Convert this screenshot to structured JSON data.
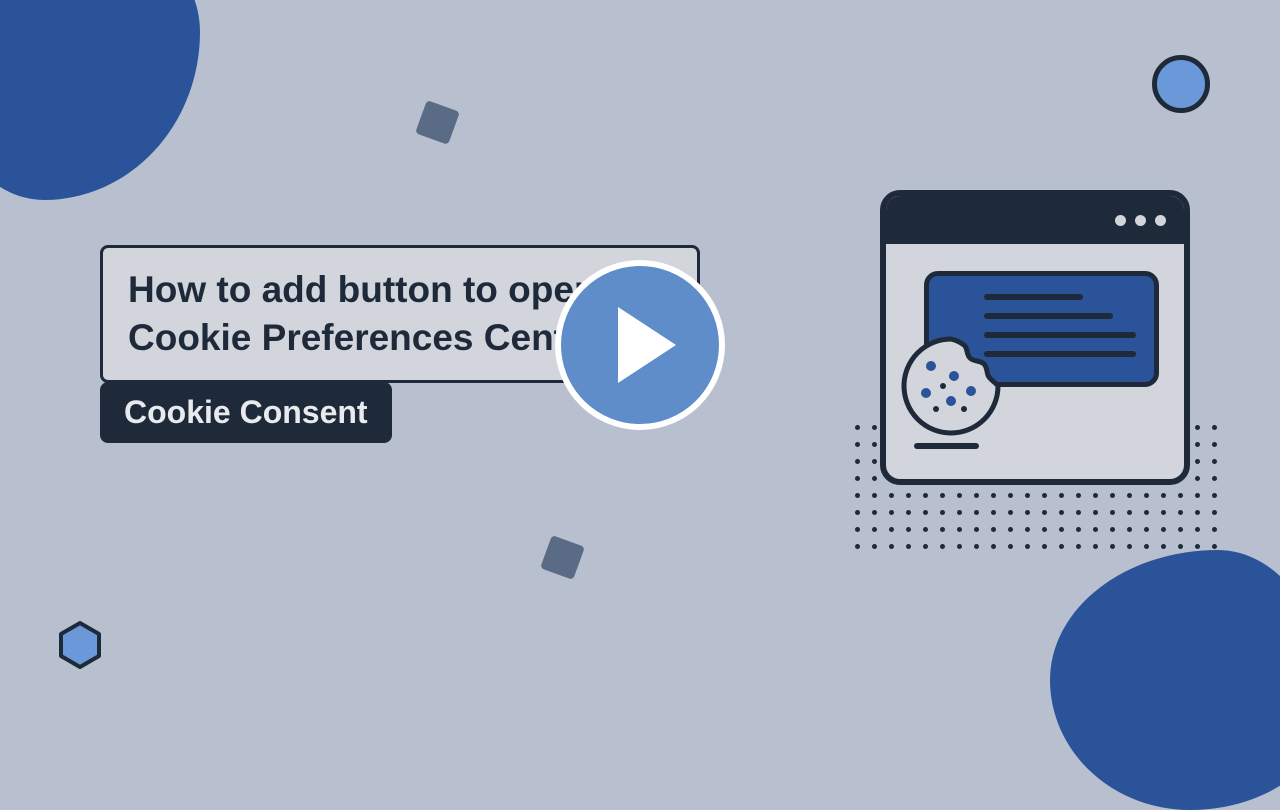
{
  "title": "How to add button to open Cookie Preferences Center in",
  "subtitle": "Cookie Consent",
  "colors": {
    "background": "#b8c0cf",
    "accent_blue": "#2a5399",
    "dark": "#1e2a3a",
    "play_blue": "#5e8dc9",
    "light_blue": "#6a98d8"
  },
  "play_button": "Play video",
  "browser_dots": 3,
  "cookie_chip_count": 8
}
